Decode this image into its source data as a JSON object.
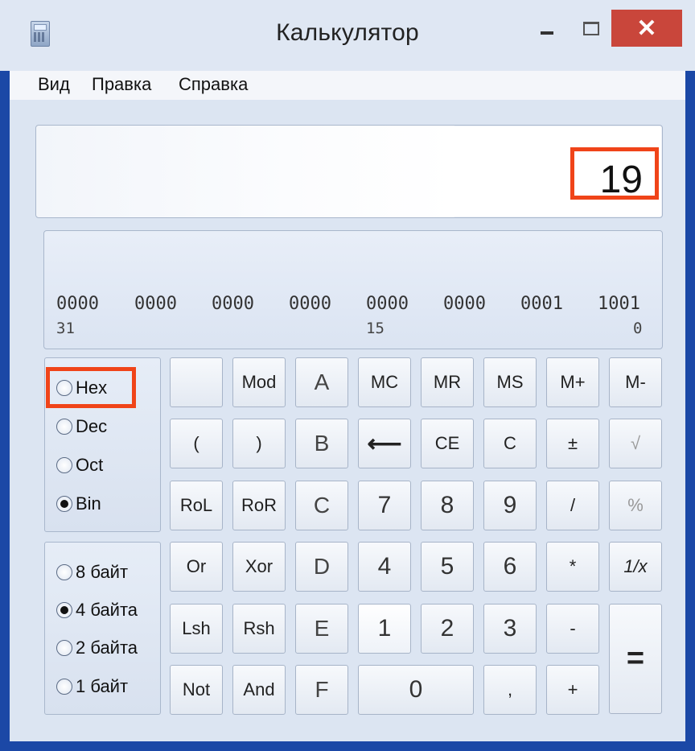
{
  "window": {
    "title": "Калькулятор",
    "minimize_symbol": "",
    "maximize_symbol": "",
    "close_symbol": "✕"
  },
  "menu": [
    "Вид",
    "Правка",
    "Справка"
  ],
  "display": {
    "value": "19"
  },
  "bits": {
    "groups": [
      "0000",
      "0000",
      "0000",
      "0000",
      "0000",
      "0000",
      "0001",
      "1001"
    ],
    "indices": [
      "31",
      "15",
      "0"
    ]
  },
  "base_options": [
    {
      "label": "Hex",
      "checked": false
    },
    {
      "label": "Dec",
      "checked": false
    },
    {
      "label": "Oct",
      "checked": false
    },
    {
      "label": "Bin",
      "checked": true
    }
  ],
  "word_size_options": [
    {
      "label": "8 байт",
      "checked": false
    },
    {
      "label": "4 байта",
      "checked": true
    },
    {
      "label": "2 байта",
      "checked": false
    },
    {
      "label": "1 байт",
      "checked": false
    }
  ],
  "keys": {
    "row1": [
      "",
      "Mod",
      "A",
      "MC",
      "MR",
      "MS",
      "M+",
      "M-"
    ],
    "row2": [
      "(",
      ")",
      "B",
      "⟵",
      "CE",
      "C",
      "±",
      "√"
    ],
    "row3": [
      "RoL",
      "RoR",
      "C",
      "7",
      "8",
      "9",
      "/",
      "%"
    ],
    "row4": [
      "Or",
      "Xor",
      "D",
      "4",
      "5",
      "6",
      "*",
      "1/x"
    ],
    "row5": [
      "Lsh",
      "Rsh",
      "E",
      "1",
      "2",
      "3",
      "-"
    ],
    "row6": [
      "Not",
      "And",
      "F",
      "0",
      ",",
      "+"
    ],
    "equals": "="
  },
  "colors": {
    "highlight": "#f04419",
    "frame": "#1b48a6",
    "close": "#c9463b"
  }
}
